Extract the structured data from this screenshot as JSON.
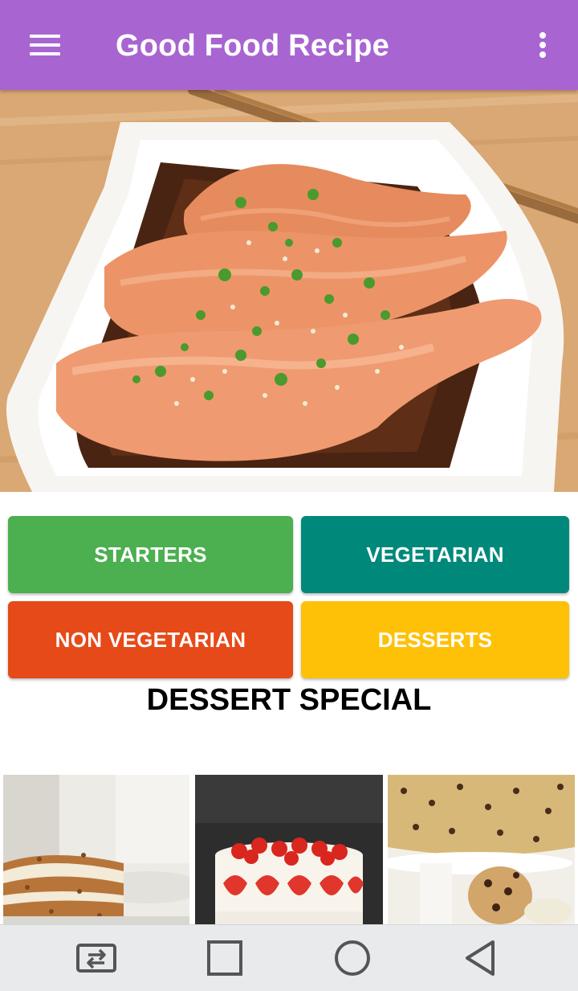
{
  "app_bar": {
    "title": "Good Food Recipe",
    "menu_icon": "hamburger-menu-icon",
    "overflow_icon": "more-vertical-icon",
    "background_color": "#a865d1"
  },
  "categories": [
    {
      "label": "STARTERS",
      "color": "#4caf50"
    },
    {
      "label": "VEGETARIAN",
      "color": "#00897b"
    },
    {
      "label": "NON VEGETARIAN",
      "color": "#e64a19"
    },
    {
      "label": "DESSERTS",
      "color": "#ffc107"
    }
  ],
  "section": {
    "title": "DESSERT SPECIAL"
  },
  "nav_bar": {
    "icons": [
      "switch-app-icon",
      "recents-square-icon",
      "home-circle-icon",
      "back-triangle-icon"
    ]
  }
}
